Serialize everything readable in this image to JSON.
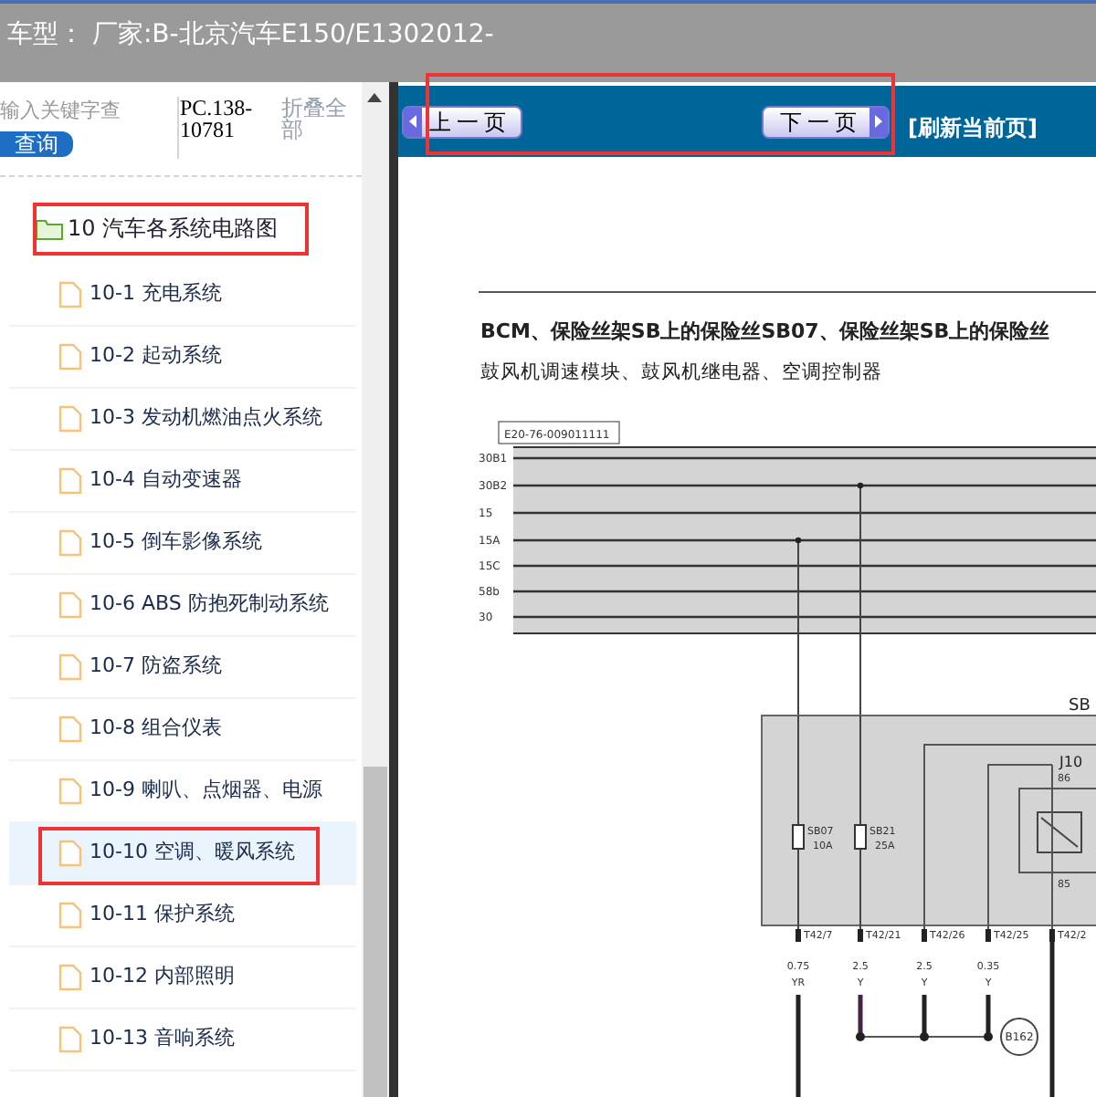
{
  "title_bar": {
    "text": "车型： 厂家:B-北京汽车E150/E1302012-"
  },
  "sidebar": {
    "search": {
      "placeholder": "输入关键字查"
    },
    "search_button": "查询",
    "code": "PC.138-10781",
    "collapse_all": "折叠全部",
    "folder": {
      "label": "10 汽车各系统电路图",
      "expanded": true
    },
    "items": [
      {
        "label": "10-1 充电系统",
        "selected": false
      },
      {
        "label": "10-2 起动系统",
        "selected": false
      },
      {
        "label": "10-3 发动机燃油点火系统",
        "selected": false
      },
      {
        "label": "10-4 自动变速器",
        "selected": false
      },
      {
        "label": "10-5 倒车影像系统",
        "selected": false
      },
      {
        "label": "10-6 ABS 防抱死制动系统",
        "selected": false
      },
      {
        "label": "10-7 防盗系统",
        "selected": false
      },
      {
        "label": "10-8 组合仪表",
        "selected": false
      },
      {
        "label": "10-9 喇叭、点烟器、电源",
        "selected": false
      },
      {
        "label": "10-10 空调、暖风系统",
        "selected": true
      },
      {
        "label": "10-11 保护系统",
        "selected": false
      },
      {
        "label": "10-12 内部照明",
        "selected": false
      },
      {
        "label": "10-13 音响系统",
        "selected": false
      }
    ]
  },
  "nav": {
    "prev": "上一页",
    "next": "下一页",
    "refresh": "[刷新当前页]"
  },
  "document": {
    "heading": [
      "BCM、保险丝架SB上的保险丝SB07、保险丝架SB上的保险丝",
      "鼓风机调速模块、鼓风机继电器、空调控制器"
    ],
    "diagram": {
      "tag": "E20-76-009011111",
      "buses": [
        "30B1",
        "30B2",
        "15",
        "15A",
        "15C",
        "58b",
        "30"
      ],
      "box_label": "SB",
      "relay_label": "J10",
      "relay_pins": [
        "86",
        "85"
      ],
      "fuses": [
        {
          "name": "SB07",
          "rating": "10A"
        },
        {
          "name": "SB21",
          "rating": "25A"
        }
      ],
      "wires": [
        {
          "pin": "T42/7",
          "gauge": "0.75",
          "code": "YR"
        },
        {
          "pin": "T42/21",
          "gauge": "2.5",
          "code": "Y"
        },
        {
          "pin": "T42/26",
          "gauge": "2.5",
          "code": "Y"
        },
        {
          "pin": "T42/25",
          "gauge": "0.35",
          "code": "Y"
        },
        {
          "pin": "T42/2"
        }
      ],
      "splice": "B162"
    }
  }
}
